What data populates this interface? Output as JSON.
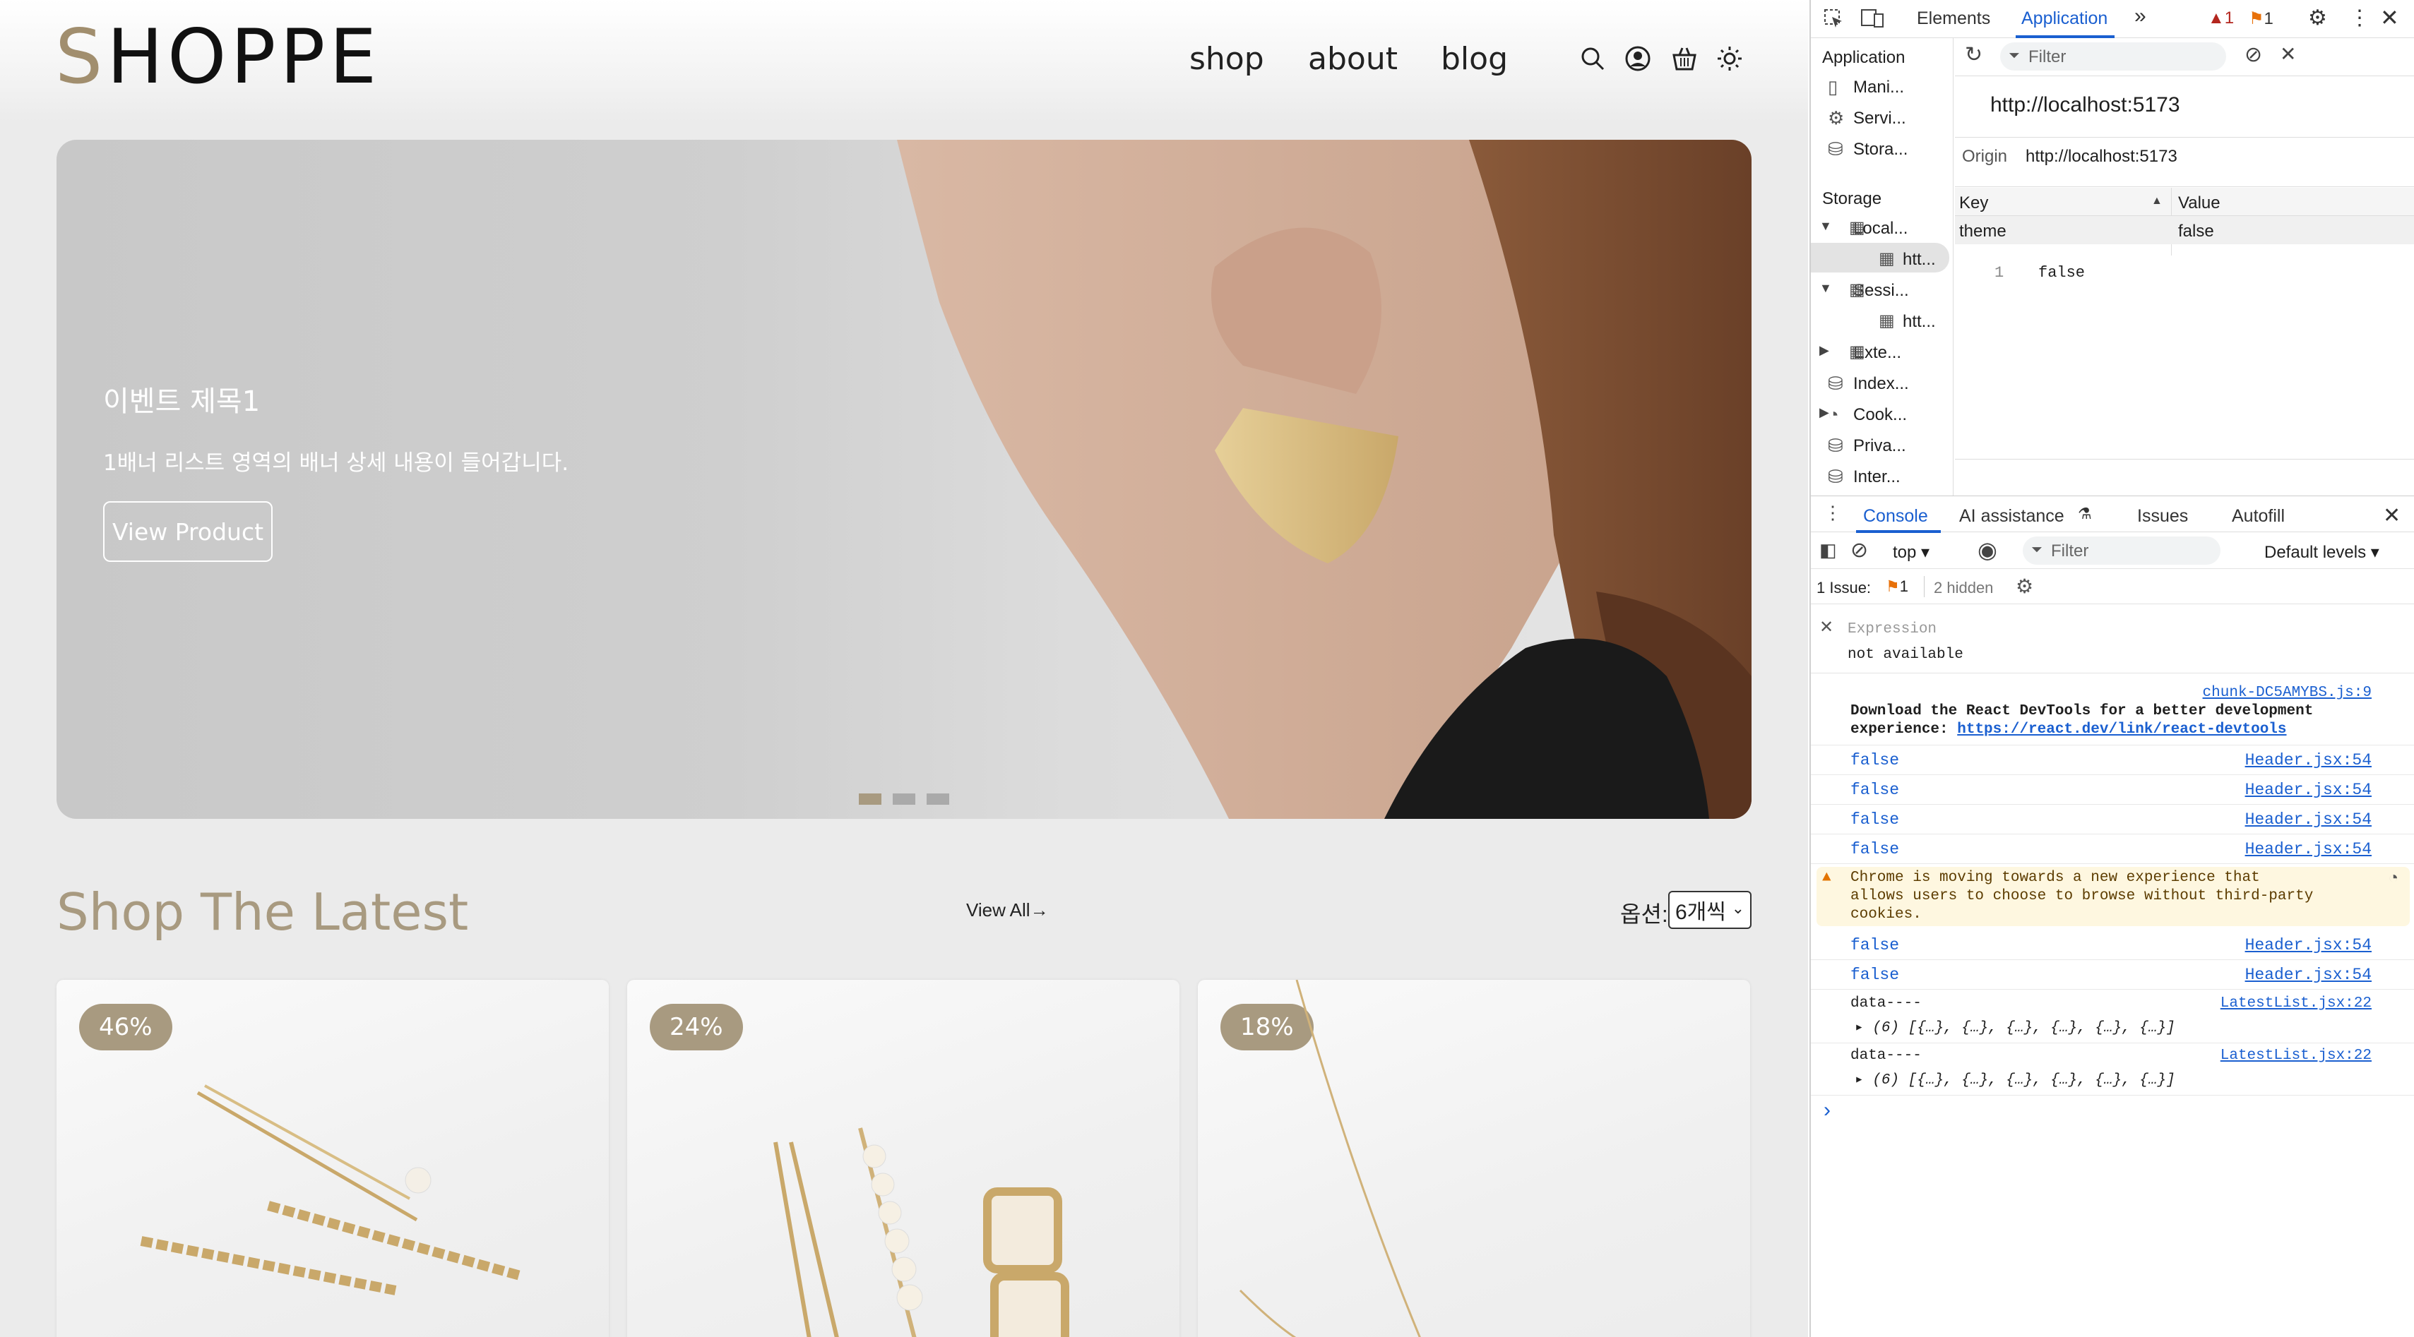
{
  "site": {
    "logo": "SHOPPE",
    "nav": [
      "shop",
      "about",
      "blog"
    ],
    "hero": {
      "title": "이벤트 제목1",
      "desc": "1배너 리스트 영역의 배너 상세 내용이 들어갑니다.",
      "button": "View Product"
    },
    "latest": {
      "title": "Shop The Latest",
      "view_all": "View All→",
      "option_label": "옵션:",
      "option_value": "6개씩"
    },
    "cards": [
      {
        "badge": "46%"
      },
      {
        "badge": "24%"
      },
      {
        "badge": "18%"
      }
    ]
  },
  "devtools": {
    "tabs": [
      "Elements",
      "Application"
    ],
    "warn_count": "1",
    "issue_count": "1",
    "filter_placeholder": "Filter",
    "sidebar": {
      "app_header": "Application",
      "app_items": [
        "Mani...",
        "Servi...",
        "Stora..."
      ],
      "storage_header": "Storage",
      "storage_items": [
        "Local...",
        "htt...",
        "Sessi...",
        "htt...",
        "Exte...",
        "Index...",
        "Cook...",
        "Priva...",
        "Inter..."
      ]
    },
    "origin_url": "http://localhost:5173",
    "origin_label": "Origin",
    "origin_value": "http://localhost:5173",
    "table": {
      "col_key": "Key",
      "col_value": "Value",
      "rows": [
        {
          "key": "theme",
          "value": "false"
        }
      ]
    },
    "preview": {
      "line": "1",
      "value": "false"
    },
    "drawer_tabs": [
      "Console",
      "AI assistance",
      "Issues",
      "Autofill"
    ],
    "console": {
      "context": "top ▾",
      "filter": "Filter",
      "levels": "Default levels ▾",
      "issues_label": "1 Issue:",
      "issues_count": "1",
      "hidden": "2 hidden",
      "expression_label": "Expression",
      "expression_value": "not available",
      "react_src": "chunk-DC5AMYBS.js:9",
      "react_msg1": "Download the React DevTools for a better development",
      "react_msg2": "experience: ",
      "react_link": "https://react.dev/link/react-devtools",
      "logs_a": [
        {
          "v": "false",
          "s": "Header.jsx:54"
        },
        {
          "v": "false",
          "s": "Header.jsx:54"
        },
        {
          "v": "false",
          "s": "Header.jsx:54"
        },
        {
          "v": "false",
          "s": "Header.jsx:54"
        }
      ],
      "warning": [
        "Chrome is moving towards a new experience that",
        "allows users to choose to browse without third-party",
        "cookies."
      ],
      "logs_b": [
        {
          "v": "false",
          "s": "Header.jsx:54"
        },
        {
          "v": "false",
          "s": "Header.jsx:54"
        }
      ],
      "data_logs": [
        {
          "label": "data----",
          "src": "LatestList.jsx:22",
          "detail": "▸ (6) [{…}, {…}, {…}, {…}, {…}, {…}]"
        },
        {
          "label": "data----",
          "src": "LatestList.jsx:22",
          "detail": "▸ (6) [{…}, {…}, {…}, {…}, {…}, {…}]"
        }
      ],
      "prompt": "›"
    }
  }
}
